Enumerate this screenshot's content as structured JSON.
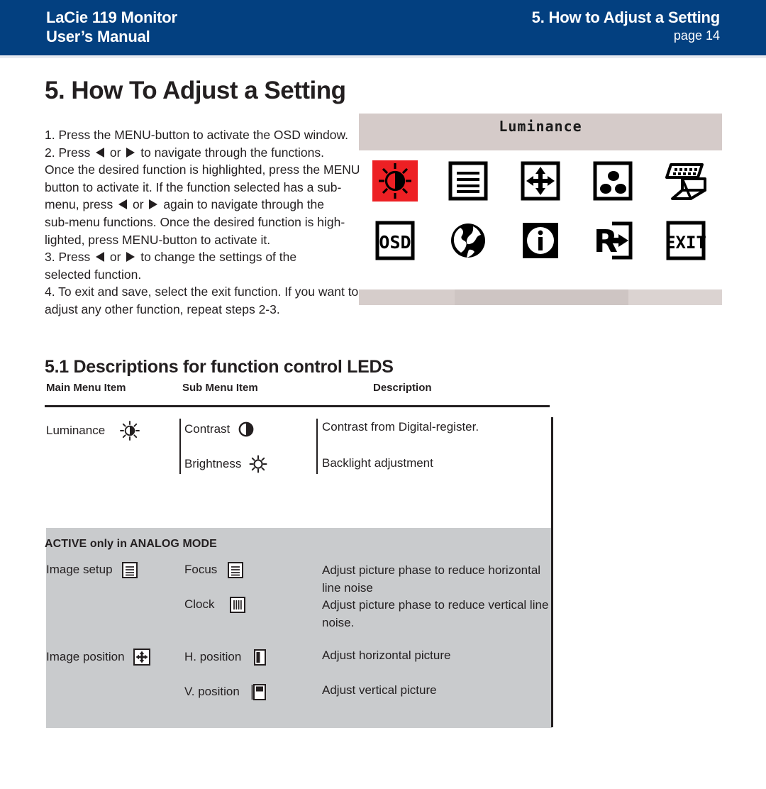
{
  "header": {
    "product": "LaCie 119 Monitor",
    "manual": "User’s Manual",
    "section": "5. How to Adjust a Setting",
    "page": "page 14",
    "bg_color": "#034080",
    "text_color": "#ffffff"
  },
  "page_title": "5. How To Adjust a Setting",
  "instructions": {
    "lines": [
      "1. Press the MENU-button to activate the OSD window.",
      "2. Press  ◀  or  ▶  to navigate through the functions.",
      "Once the desired function is highlighted, press the MENU-",
      "button  to activate it.  If the function selected has a sub-",
      "menu, press  ◀  or  ▶  again to navigate through the",
      "sub-menu functions.  Once the desired function is high-",
      "lighted, press MENU-button to activate it.",
      "3. Press  ◀  or  ▶  to change the settings of the",
      "selected function.",
      "4. To exit and save, select the exit function. If you want to",
      "adjust any other function, repeat steps 2-3."
    ]
  },
  "osd": {
    "title": "Luminance",
    "titlebar_color": "#d5cbc9",
    "highlight_color": "#ed2024",
    "icons_row1": [
      {
        "name": "luminance-icon",
        "label": "Luminance",
        "selected": true
      },
      {
        "name": "image-setup-icon",
        "label": "Image Setup",
        "selected": false
      },
      {
        "name": "image-position-icon",
        "label": "Image Position",
        "selected": false
      },
      {
        "name": "color-temperature-icon",
        "label": "Color Temperature",
        "selected": false
      },
      {
        "name": "input-signal-icon",
        "label": "Input Signal",
        "selected": false
      }
    ],
    "icons_row2": [
      {
        "name": "osd-setup-icon",
        "label": "OSD",
        "selected": false
      },
      {
        "name": "language-globe-icon",
        "label": "Language",
        "selected": false
      },
      {
        "name": "information-icon",
        "label": "Information",
        "selected": false
      },
      {
        "name": "reset-icon",
        "label": "Reset",
        "selected": false
      },
      {
        "name": "exit-icon",
        "label": "EXIT",
        "selected": false
      }
    ]
  },
  "section": {
    "title": "5.1 Descriptions for function control LEDS",
    "columns": {
      "main": "Main Menu Item",
      "sub": "Sub Menu Item",
      "description": "Description"
    },
    "analog_note": "ACTIVE only in ANALOG MODE",
    "rows": [
      {
        "main": "Luminance",
        "main_icon": "sun-contrast-icon",
        "subs": [
          {
            "label": "Contrast",
            "icon": "half-circle-icon",
            "description": "Contrast from Digital-register."
          },
          {
            "label": "Brightness",
            "icon": "sun-icon",
            "description": "Backlight adjustment"
          }
        ]
      },
      {
        "main": "Image setup",
        "main_icon": "lines-box-icon",
        "subs": [
          {
            "label": "Focus",
            "icon": "lines-box-icon",
            "description": "Adjust picture phase to reduce horizontal line noise"
          },
          {
            "label": "Clock",
            "icon": "vertical-bars-box-icon",
            "description": "Adjust picture phase to reduce vertical line noise."
          }
        ]
      },
      {
        "main": "Image position",
        "main_icon": "move-arrows-box-icon",
        "subs": [
          {
            "label": "H. position",
            "icon": "h-position-icon",
            "description": "Adjust horizontal picture"
          },
          {
            "label": "V. position",
            "icon": "v-position-icon",
            "description": "Adjust vertical picture"
          }
        ]
      }
    ]
  },
  "colors": {
    "header_blue": "#034080",
    "grey_panel": "#c9cbcd",
    "osd_titlebar": "#d5cbc9",
    "red_highlight": "#ed2024",
    "ink": "#231f20"
  }
}
